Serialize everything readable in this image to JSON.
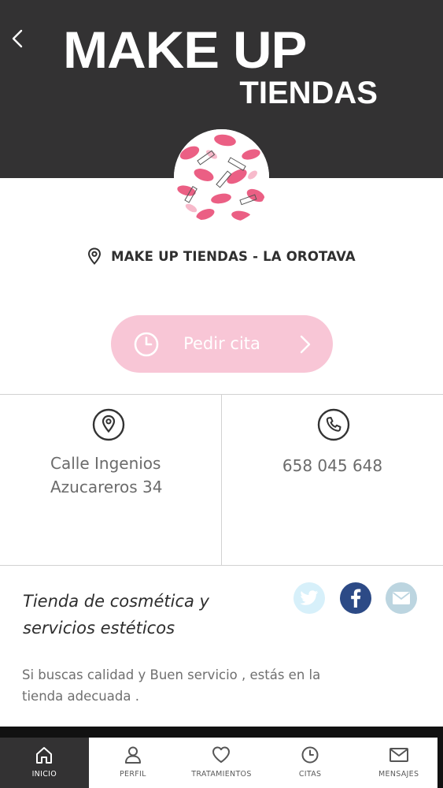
{
  "header": {
    "brand_line1": "MAKE UP",
    "brand_line2": "TIENDAS",
    "back_icon": "chevron-left-icon"
  },
  "profile": {
    "avatar": "lipstick-kiss-pattern-image",
    "store_name": "MAKE UP TIENDAS - LA OROTAVA",
    "location_icon": "map-pin-icon"
  },
  "appointment_button": {
    "label": "Pedir cita",
    "icon": "clock-icon",
    "chevron": "chevron-right-icon",
    "color": "#f8c6d6"
  },
  "contact": {
    "address_line1": "Calle Ingenios",
    "address_line2": "Azucareros 34",
    "address_icon": "map-pin-circle-icon",
    "phone": "658 045 648",
    "phone_icon": "phone-circle-icon"
  },
  "description": {
    "title_line1": "Tienda de cosmética y",
    "title_line2": "servicios estéticos",
    "body_line1": "Si buscas calidad y Buen servicio , estás en la",
    "body_line2": "tienda adecuada ."
  },
  "social": {
    "twitter_icon": "twitter-icon",
    "facebook_icon": "facebook-icon",
    "mail_icon": "mail-icon",
    "twitter_color": "#d7f0fa",
    "facebook_color": "#2c4a86",
    "mail_color": "#bcd5e0"
  },
  "nav": {
    "items": [
      {
        "label": "INICIO",
        "icon": "home-icon",
        "active": true
      },
      {
        "label": "PERFIL",
        "icon": "user-icon",
        "active": false
      },
      {
        "label": "TRATAMIENTOS",
        "icon": "heart-icon",
        "active": false
      },
      {
        "label": "CITAS",
        "icon": "clock-icon",
        "active": false
      },
      {
        "label": "MENSAJES",
        "icon": "envelope-icon",
        "active": false
      }
    ]
  },
  "colors": {
    "header_bg": "#333233",
    "accent_pink": "#f8c6d6"
  }
}
